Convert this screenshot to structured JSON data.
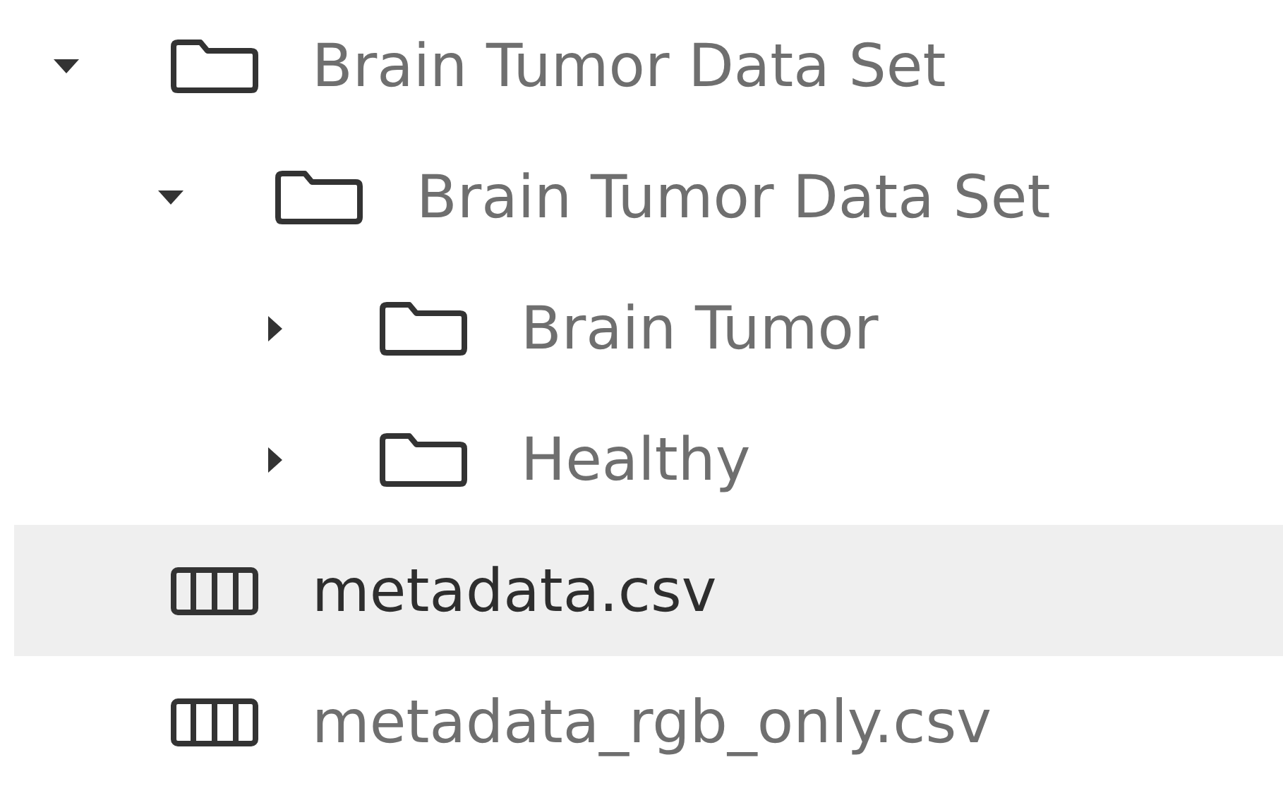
{
  "tree": [
    {
      "kind": "folder",
      "label": "Brain Tumor Data Set",
      "expanded": true,
      "selected": false,
      "children": [
        {
          "kind": "folder",
          "label": "Brain Tumor Data Set",
          "expanded": true,
          "selected": false,
          "children": [
            {
              "kind": "folder",
              "label": "Brain Tumor",
              "expanded": false,
              "selected": false
            },
            {
              "kind": "folder",
              "label": "Healthy",
              "expanded": false,
              "selected": false
            }
          ]
        }
      ]
    },
    {
      "kind": "file",
      "label": "metadata.csv",
      "selected": true
    },
    {
      "kind": "file",
      "label": "metadata_rgb_only.csv",
      "selected": false
    }
  ]
}
